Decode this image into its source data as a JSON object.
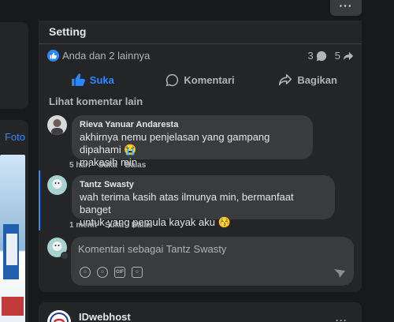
{
  "top_more_label": "···",
  "left": {
    "photo_link": "Foto"
  },
  "post": {
    "title": "Setting",
    "reactions_text": "Anda dan 2 lainnya",
    "comment_count": "3",
    "share_count": "5",
    "actions": {
      "like": "Suka",
      "comment": "Komentari",
      "share": "Bagikan"
    },
    "see_more": "Lihat komentar lain"
  },
  "comments": [
    {
      "name": "Rieva Yanuar Andaresta",
      "text_line1": "akhirnya nemu penjelasan yang gampang dipahami 😭",
      "text_line2": "makasih min",
      "time": "5 hari",
      "like": "Suka",
      "reply": "Balas"
    },
    {
      "name": "Tantz Swasty",
      "text_line1": "wah terima kasih atas ilmunya min, bermanfaat banget",
      "text_line2": "untuk yang pemula kayak aku 😚",
      "time": "1 menit",
      "like": "Suka",
      "reply": "Balas"
    }
  ],
  "composer": {
    "placeholder": "Komentari sebagai Tantz Swasty",
    "icons": [
      "sticker-icon",
      "emoji-icon",
      "gif-icon",
      "avatar-sticker-icon"
    ]
  },
  "next_post": {
    "page_name": "IDwebhost",
    "more": "···"
  },
  "colors": {
    "accent": "#2d88ff",
    "card": "#242526",
    "bubble": "#3a3b3c",
    "bg": "#18191a"
  }
}
